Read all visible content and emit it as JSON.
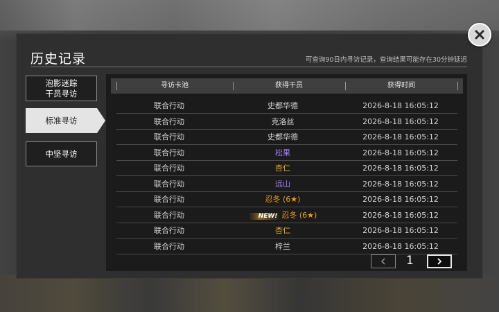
{
  "header": {
    "title": "历史记录",
    "subtitle": "可查询90日内寻访记录，查询结果可能存在30分钟延迟"
  },
  "tabs": [
    {
      "label": "泡影迷踪\n干员寻访",
      "active": false
    },
    {
      "label": "标准寻访",
      "active": true
    },
    {
      "label": "中坚寻访",
      "active": false
    }
  ],
  "table": {
    "columns": [
      "寻访卡池",
      "获得干员",
      "获得时间"
    ],
    "rows": [
      {
        "pool": "联合行动",
        "operator": "史都华德",
        "time": "2026-8-18 16:05:12",
        "rarity": 3,
        "new": false
      },
      {
        "pool": "联合行动",
        "operator": "克洛丝",
        "time": "2026-8-18 16:05:12",
        "rarity": 3,
        "new": false
      },
      {
        "pool": "联合行动",
        "operator": "史都华德",
        "time": "2026-8-18 16:05:12",
        "rarity": 3,
        "new": false
      },
      {
        "pool": "联合行动",
        "operator": "松果",
        "time": "2026-8-18 16:05:12",
        "rarity": 4,
        "new": false
      },
      {
        "pool": "联合行动",
        "operator": "杏仁",
        "time": "2026-8-18 16:05:12",
        "rarity": 5,
        "new": false
      },
      {
        "pool": "联合行动",
        "operator": "远山",
        "time": "2026-8-18 16:05:12",
        "rarity": 4,
        "new": false
      },
      {
        "pool": "联合行动",
        "operator": "忍冬 (6★)",
        "time": "2026-8-18 16:05:12",
        "rarity": 6,
        "new": false
      },
      {
        "pool": "联合行动",
        "operator": "忍冬 (6★)",
        "time": "2026-8-18 16:05:12",
        "rarity": 6,
        "new": true
      },
      {
        "pool": "联合行动",
        "operator": "杏仁",
        "time": "2026-8-18 16:05:12",
        "rarity": 5,
        "new": false
      },
      {
        "pool": "联合行动",
        "operator": "梓兰",
        "time": "2026-8-18 16:05:12",
        "rarity": 3,
        "new": false
      }
    ],
    "new_tag": "NEW!"
  },
  "pager": {
    "current_page": "1",
    "prev_icon": "chevron-left-icon",
    "next_icon": "chevron-right-icon"
  },
  "close_icon": "close-icon",
  "colors": {
    "rarity_4": "#a57eff",
    "rarity_5": "#f2b12a",
    "rarity_6": "#f29b1f",
    "active_tab": "#e4e4e4"
  }
}
